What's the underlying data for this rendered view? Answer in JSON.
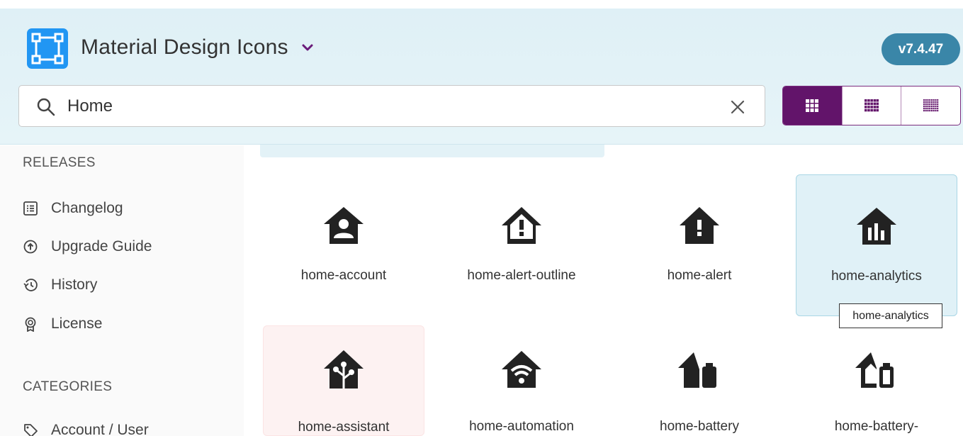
{
  "header": {
    "title": "Material Design Icons",
    "version": "v7.4.47",
    "logo_icon": "mdi-logo-icon",
    "accent_color": "#62146a",
    "version_color": "#3a86a8"
  },
  "search": {
    "value": "Home",
    "placeholder": "Search"
  },
  "view_toggle": {
    "options": [
      "grid-large",
      "grid-medium",
      "grid-small"
    ],
    "selected": "grid-large"
  },
  "sidebar": {
    "releases_heading": "RELEASES",
    "releases": [
      {
        "label": "Changelog",
        "icon": "list-box-icon"
      },
      {
        "label": "Upgrade Guide",
        "icon": "arrow-up-circle-icon"
      },
      {
        "label": "History",
        "icon": "history-icon"
      },
      {
        "label": "License",
        "icon": "license-badge-icon"
      }
    ],
    "categories_heading": "CATEGORIES",
    "categories": [
      {
        "label": "Account / User",
        "icon": "tag-outline-icon"
      }
    ]
  },
  "icons": [
    {
      "name": "home-account",
      "icon": "home-account-icon"
    },
    {
      "name": "home-alert-outline",
      "icon": "home-alert-outline-icon"
    },
    {
      "name": "home-alert",
      "icon": "home-alert-icon"
    },
    {
      "name": "home-analytics",
      "icon": "home-analytics-icon"
    },
    {
      "name": "home-assistant",
      "icon": "home-assistant-icon"
    },
    {
      "name": "home-automation",
      "icon": "home-automation-icon"
    },
    {
      "name": "home-battery",
      "icon": "home-battery-icon"
    },
    {
      "name": "home-battery-",
      "icon": "home-battery-outline-icon"
    }
  ],
  "tooltip": {
    "text": "home-analytics"
  }
}
